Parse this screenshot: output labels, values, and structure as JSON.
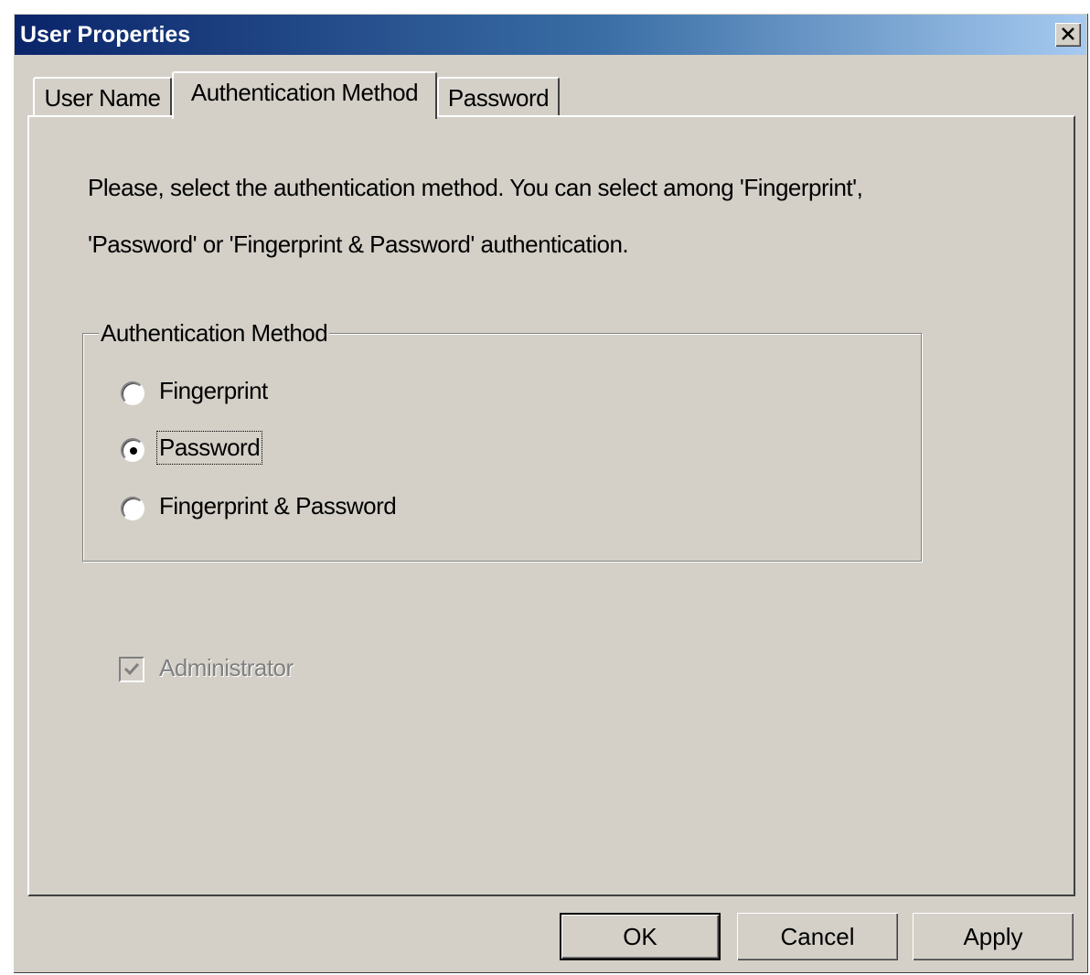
{
  "window": {
    "title": "User Properties"
  },
  "tabs": [
    {
      "label": "User Name",
      "active": false
    },
    {
      "label": "Authentication Method",
      "active": true
    },
    {
      "label": "Password",
      "active": false
    }
  ],
  "panel": {
    "description_line1": "Please, select the authentication method. You can select among 'Fingerprint',",
    "description_line2": "'Password' or 'Fingerprint & Password' authentication.",
    "group_label": "Authentication Method",
    "options": [
      {
        "label": "Fingerprint",
        "selected": false
      },
      {
        "label": "Password",
        "selected": true
      },
      {
        "label": "Fingerprint & Password",
        "selected": false
      }
    ],
    "administrator": {
      "label": "Administrator",
      "checked": true,
      "disabled": true
    }
  },
  "buttons": {
    "ok": "OK",
    "cancel": "Cancel",
    "apply": "Apply"
  },
  "colors": {
    "face": "#d4d0c8",
    "title_start": "#0a246a",
    "title_end": "#a6caf0"
  }
}
